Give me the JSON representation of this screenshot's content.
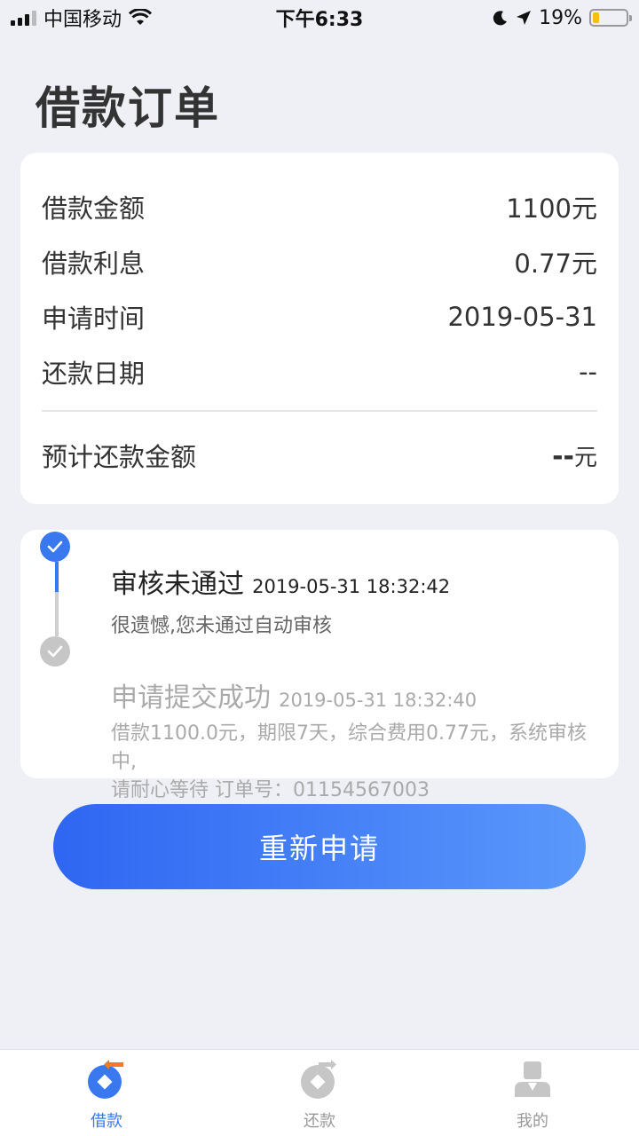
{
  "status_bar": {
    "carrier": "中国移动",
    "time": "下午6:33",
    "battery_pct": "19%",
    "battery_level": 0.19
  },
  "page": {
    "title": "借款订单"
  },
  "loan_info": {
    "rows": [
      {
        "label": "借款金额",
        "value": "1100元"
      },
      {
        "label": "借款利息",
        "value": "0.77元"
      },
      {
        "label": "申请时间",
        "value": "2019-05-31"
      },
      {
        "label": "还款日期",
        "value": "--"
      }
    ],
    "total_label": "预计还款金额",
    "total_value": "--",
    "total_unit": "元"
  },
  "timeline": [
    {
      "title": "审核未通过",
      "time": "2019-05-31 18:32:42",
      "desc": "很遗憾,您未通过自动审核",
      "status": "current"
    },
    {
      "title": "申请提交成功",
      "time": "2019-05-31 18:32:40",
      "desc_line1": "借款1100.0元，期限7天，综合费用0.77元，系统审核中,",
      "desc_line2": "请耐心等待 订单号：01154567003",
      "status": "done"
    }
  ],
  "actions": {
    "reapply_label": "重新申请"
  },
  "tabs": [
    {
      "label": "借款",
      "icon": "loan-icon",
      "active": true
    },
    {
      "label": "还款",
      "icon": "repay-icon",
      "active": false
    },
    {
      "label": "我的",
      "icon": "profile-icon",
      "active": false
    }
  ],
  "colors": {
    "accent": "#3a78f0",
    "inactive": "#c6c6c6",
    "background": "#eef0f5"
  }
}
